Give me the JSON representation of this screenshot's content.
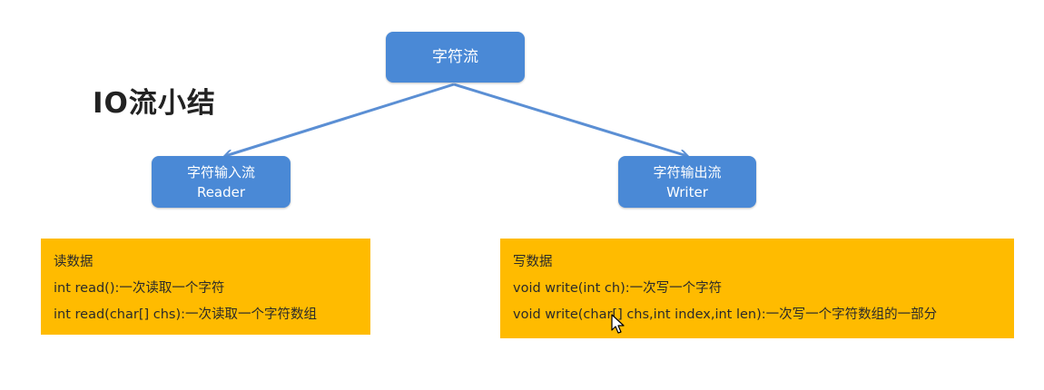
{
  "title": "IO流小结",
  "root": {
    "label": "字符流"
  },
  "reader": {
    "line1": "字符输入流",
    "line2": "Reader"
  },
  "writer": {
    "line1": "字符输出流",
    "line2": "Writer"
  },
  "read_box": {
    "heading": "读数据",
    "items": [
      "int read():一次读取一个字符",
      "int read(char[] chs):一次读取一个字符数组"
    ]
  },
  "write_box": {
    "heading": "写数据",
    "items": [
      "void write(int ch):一次写一个字符",
      "void write(char[] chs,int index,int len):一次写一个字符数组的一部分"
    ]
  },
  "colors": {
    "node_fill": "#4a89d6",
    "arrow": "#5b8fd4",
    "box_fill": "#ffbb00",
    "title_text": "#222222"
  },
  "icons": {
    "cursor": "mouse-pointer-icon"
  }
}
